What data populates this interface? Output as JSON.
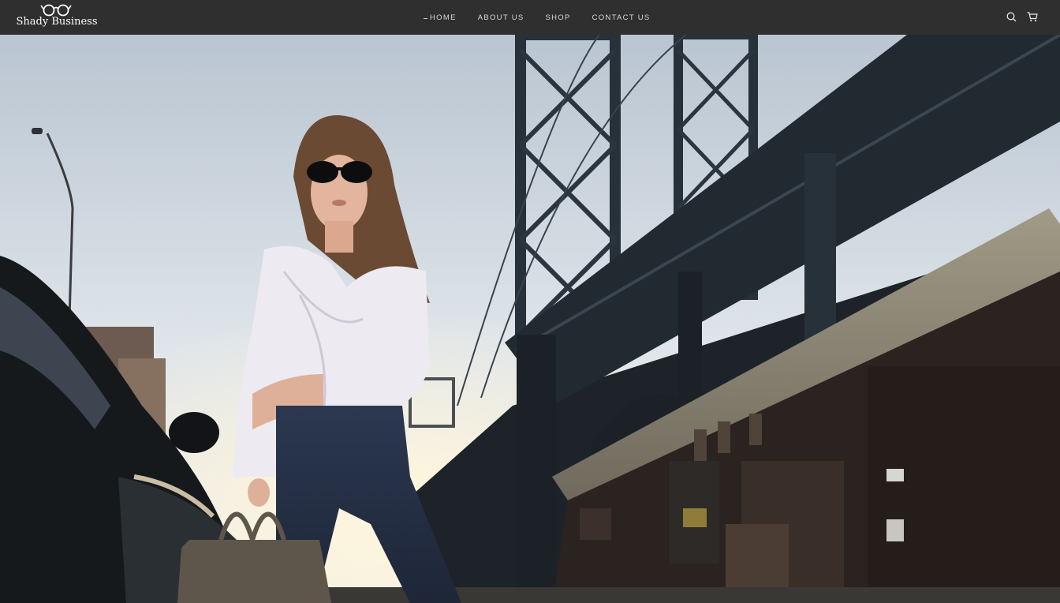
{
  "header": {
    "brand": "Shady Business",
    "logo_icon": "glasses-icon",
    "nav": [
      {
        "label": "HOME",
        "active": true
      },
      {
        "label": "ABOUT US",
        "active": false
      },
      {
        "label": "SHOP",
        "active": false
      },
      {
        "label": "CONTACT US",
        "active": false
      }
    ],
    "icons": [
      "search-icon",
      "cart-icon"
    ]
  },
  "hero": {
    "image": "hero-photo"
  },
  "colors": {
    "header_bg": "#2f2f2f",
    "nav_text": "#d8d8d8",
    "sky": "#c9d3dd",
    "bridge": "#1f262d"
  }
}
